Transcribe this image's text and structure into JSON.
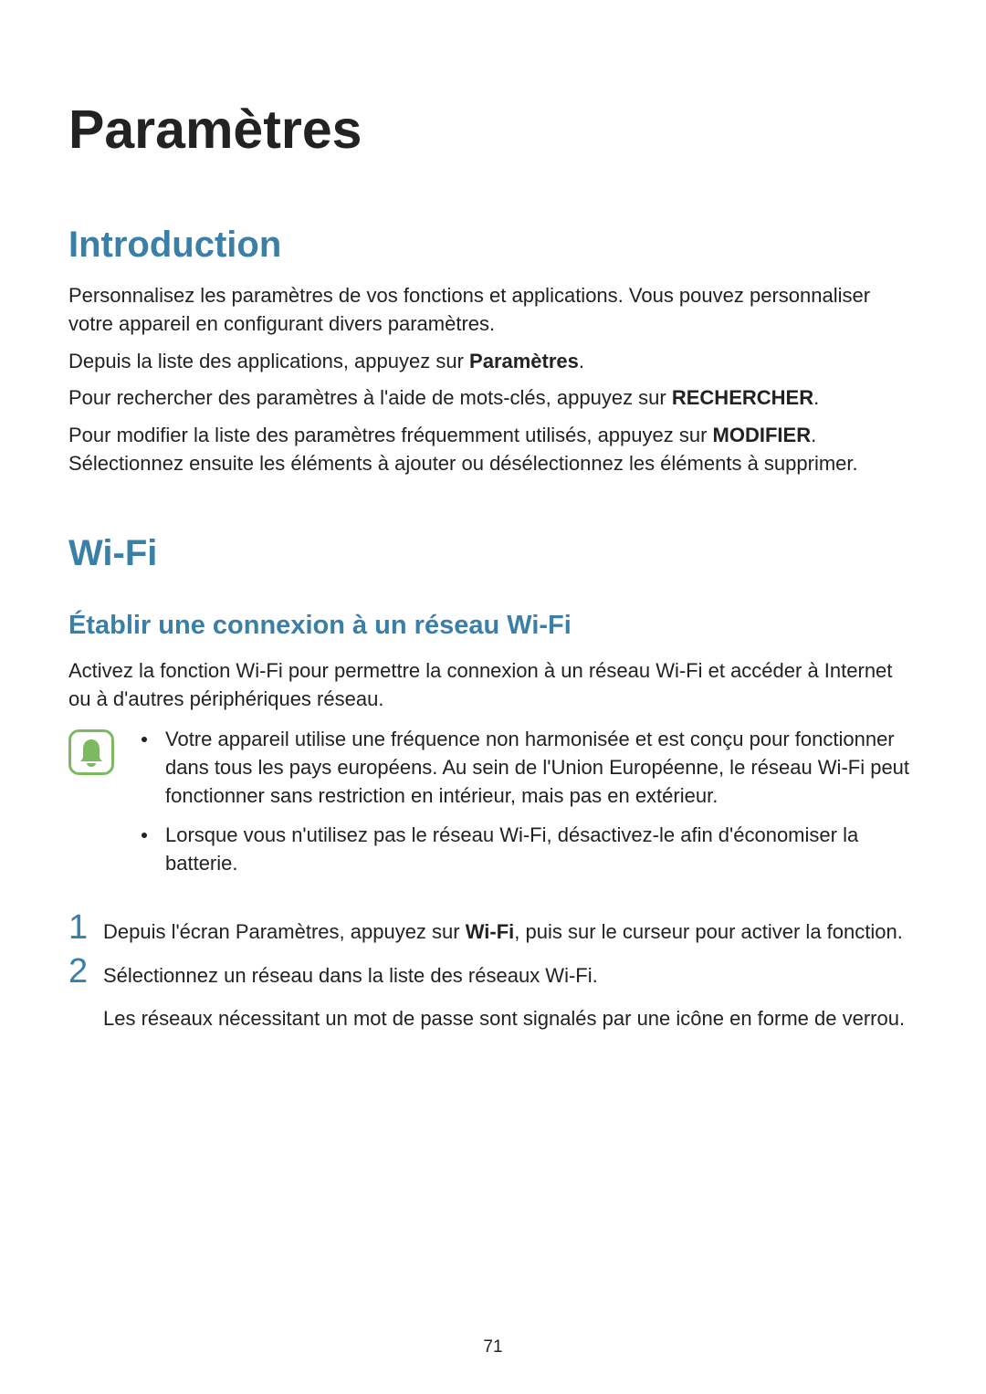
{
  "title": "Paramètres",
  "intro": {
    "heading": "Introduction",
    "p1": "Personnalisez les paramètres de vos fonctions et applications. Vous pouvez personnaliser votre appareil en configurant divers paramètres.",
    "p2_a": "Depuis la liste des applications, appuyez sur ",
    "p2_b": "Paramètres",
    "p2_c": ".",
    "p3_a": "Pour rechercher des paramètres à l'aide de mots-clés, appuyez sur ",
    "p3_b": "RECHERCHER",
    "p3_c": ".",
    "p4_a": "Pour modifier la liste des paramètres fréquemment utilisés, appuyez sur ",
    "p4_b": "MODIFIER",
    "p4_c": ". Sélectionnez ensuite les éléments à ajouter ou désélectionnez les éléments à supprimer."
  },
  "wifi": {
    "heading": "Wi-Fi",
    "sub": "Établir une connexion à un réseau Wi-Fi",
    "p1": "Activez la fonction Wi-Fi pour permettre la connexion à un réseau Wi-Fi et accéder à Internet ou à d'autres périphériques réseau.",
    "notes": {
      "b1": "Votre appareil utilise une fréquence non harmonisée et est conçu pour fonctionner dans tous les pays européens. Au sein de l'Union Européenne, le réseau Wi-Fi peut fonctionner sans restriction en intérieur, mais pas en extérieur.",
      "b2": "Lorsque vous n'utilisez pas le réseau Wi-Fi, désactivez-le afin d'économiser la batterie."
    },
    "steps": {
      "s1_num": "1",
      "s1_a": "Depuis l'écran Paramètres, appuyez sur ",
      "s1_b": "Wi-Fi",
      "s1_c": ", puis sur le curseur pour activer la fonction.",
      "s2_num": "2",
      "s2_a": "Sélectionnez un réseau dans la liste des réseaux Wi-Fi.",
      "s2_sub": "Les réseaux nécessitant un mot de passe sont signalés par une icône en forme de verrou."
    }
  },
  "pageNumber": "71"
}
